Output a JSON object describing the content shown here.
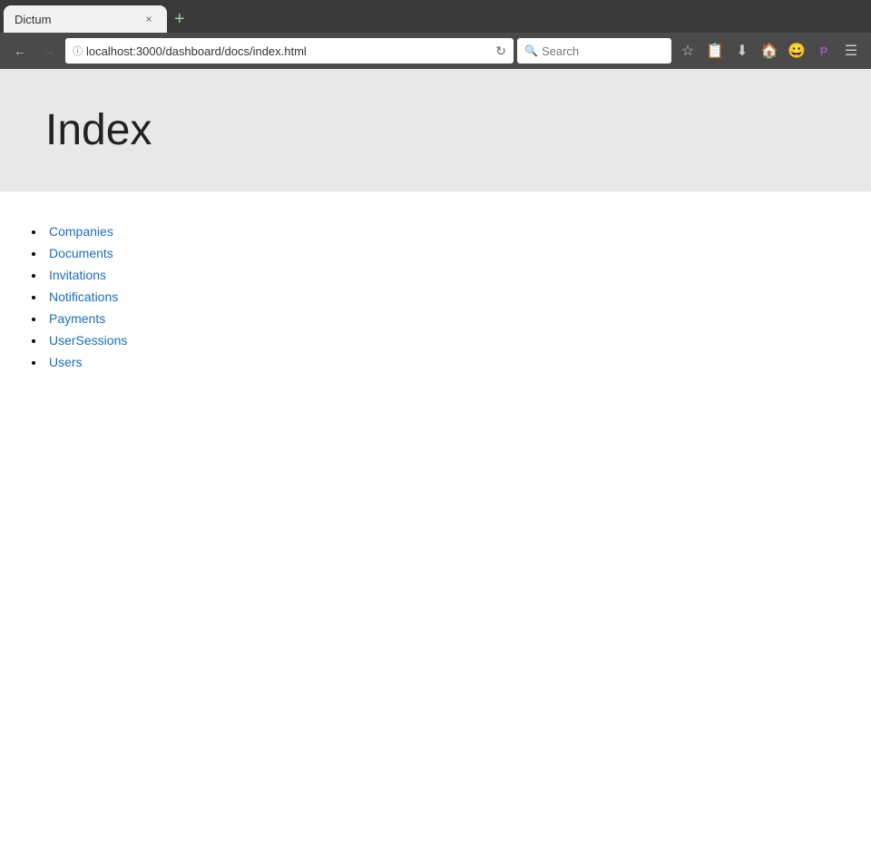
{
  "browser": {
    "tab": {
      "title": "Dictum",
      "close_label": "×"
    },
    "new_tab_label": "+",
    "address_bar": {
      "url": "localhost:3000/dashboard/docs/index.html",
      "lock_icon": "ⓘ",
      "reload_icon": "↻",
      "back_icon": "←",
      "forward_icon": "→"
    },
    "search": {
      "placeholder": "Search",
      "icon": "🔍"
    },
    "toolbar_icons": [
      {
        "name": "bookmark-star-icon",
        "glyph": "☆"
      },
      {
        "name": "reader-icon",
        "glyph": "📋"
      },
      {
        "name": "download-icon",
        "glyph": "⬇"
      },
      {
        "name": "home-icon",
        "glyph": "🏠"
      },
      {
        "name": "emoji-icon",
        "glyph": "😊"
      },
      {
        "name": "pocket-icon",
        "glyph": "🅿"
      },
      {
        "name": "menu-icon",
        "glyph": "☰"
      }
    ]
  },
  "page": {
    "title": "Index",
    "nav_links": [
      {
        "label": "Companies",
        "href": "#companies"
      },
      {
        "label": "Documents",
        "href": "#documents"
      },
      {
        "label": "Invitations",
        "href": "#invitations"
      },
      {
        "label": "Notifications",
        "href": "#notifications"
      },
      {
        "label": "Payments",
        "href": "#payments"
      },
      {
        "label": "UserSessions",
        "href": "#usersessions"
      },
      {
        "label": "Users",
        "href": "#users"
      }
    ]
  }
}
